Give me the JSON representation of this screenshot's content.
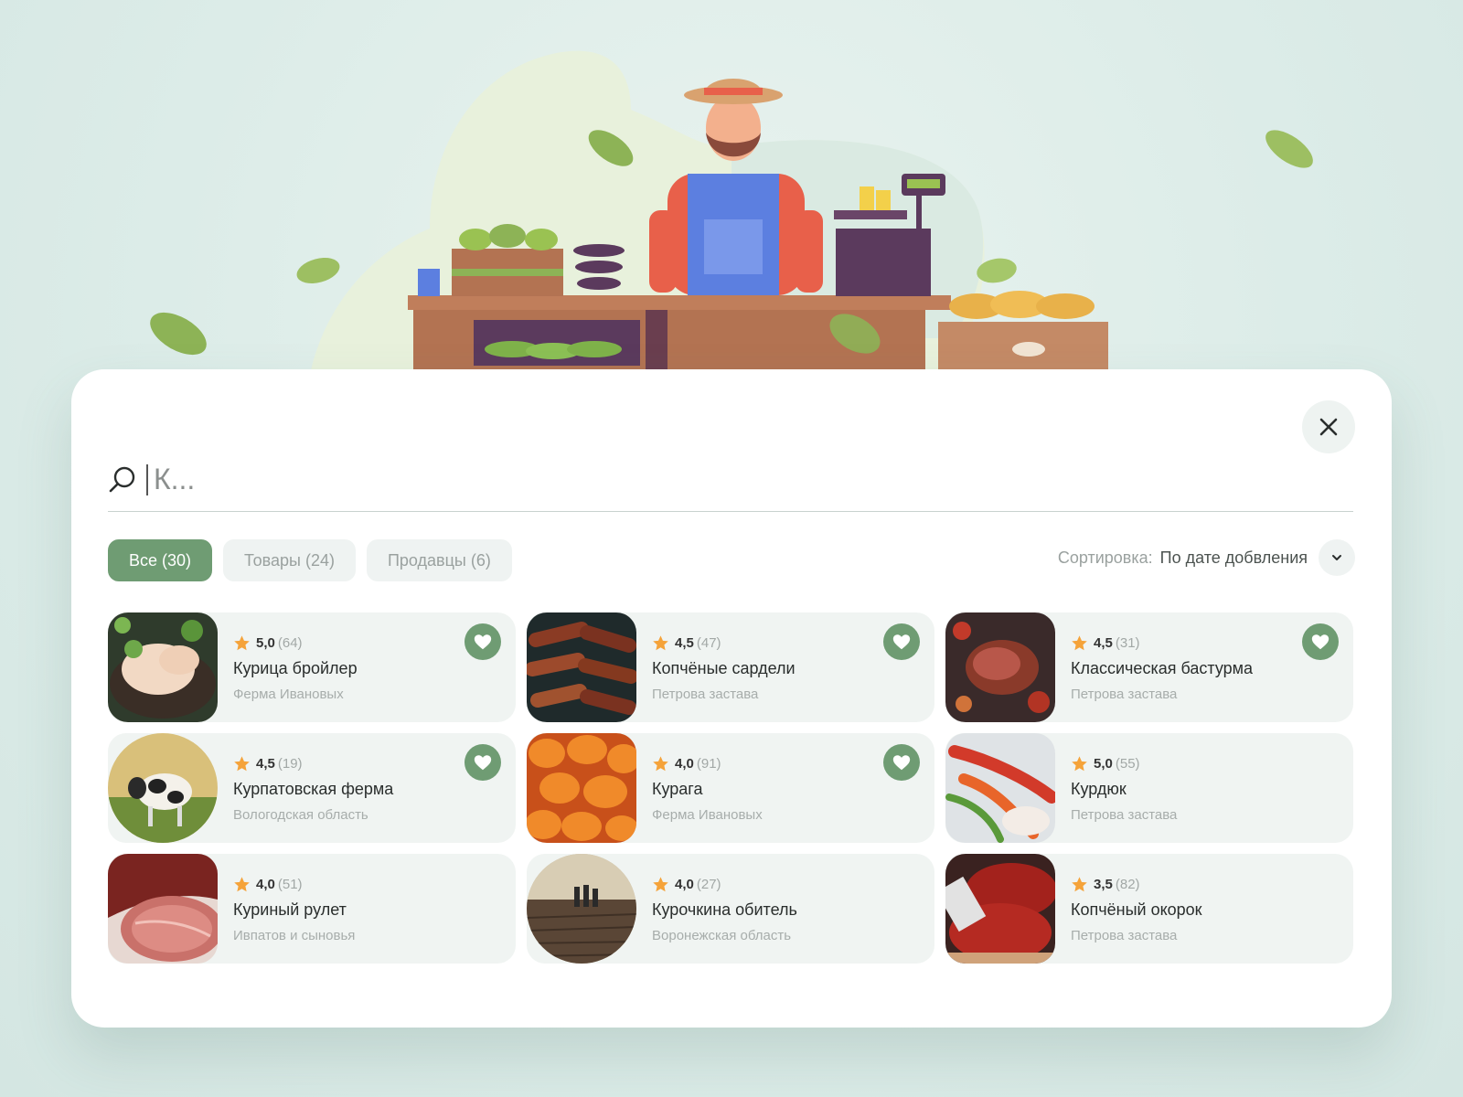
{
  "search": {
    "query": "",
    "placeholder": "К..."
  },
  "tabs": [
    {
      "label": "Все (30)",
      "active": true
    },
    {
      "label": "Товары (24)",
      "active": false
    },
    {
      "label": "Продавцы (6)",
      "active": false
    }
  ],
  "sort": {
    "label": "Сортировка:",
    "value": "По дате добвления"
  },
  "colors": {
    "accent": "#6f9c73",
    "star": "#f5a33a",
    "card_bg": "#f0f4f2"
  },
  "results": [
    {
      "score": "5,0",
      "count": "(64)",
      "title": "Курица бройлер",
      "subtitle": "Ферма Ивановых",
      "favorite": true,
      "image": "chicken-image"
    },
    {
      "score": "4,5",
      "count": "(47)",
      "title": "Копчёные сардели",
      "subtitle": "Петрова застава",
      "favorite": true,
      "image": "sausages-image"
    },
    {
      "score": "4,5",
      "count": "(31)",
      "title": "Классическая бастурма",
      "subtitle": "Петрова застава",
      "favorite": true,
      "image": "basturma-image"
    },
    {
      "score": "4,5",
      "count": "(19)",
      "title": "Курпатовская ферма",
      "subtitle": "Вологодская область",
      "favorite": true,
      "image": "cow-image"
    },
    {
      "score": "4,0",
      "count": "(91)",
      "title": "Курага",
      "subtitle": "Ферма Ивановых",
      "favorite": true,
      "image": "apricots-image"
    },
    {
      "score": "5,0",
      "count": "(55)",
      "title": "Курдюк",
      "subtitle": "Петрова застава",
      "favorite": false,
      "image": "peppers-fat-image"
    },
    {
      "score": "4,0",
      "count": "(51)",
      "title": "Куриный рулет",
      "subtitle": "Ивпатов и сыновья",
      "favorite": false,
      "image": "ham-roll-image"
    },
    {
      "score": "4,0",
      "count": "(27)",
      "title": "Курочкина обитель",
      "subtitle": "Воронежская область",
      "favorite": false,
      "image": "field-farmers-image"
    },
    {
      "score": "3,5",
      "count": "(82)",
      "title": "Копчёный окорок",
      "subtitle": "Петрова застава",
      "favorite": false,
      "image": "raw-meat-image"
    }
  ]
}
